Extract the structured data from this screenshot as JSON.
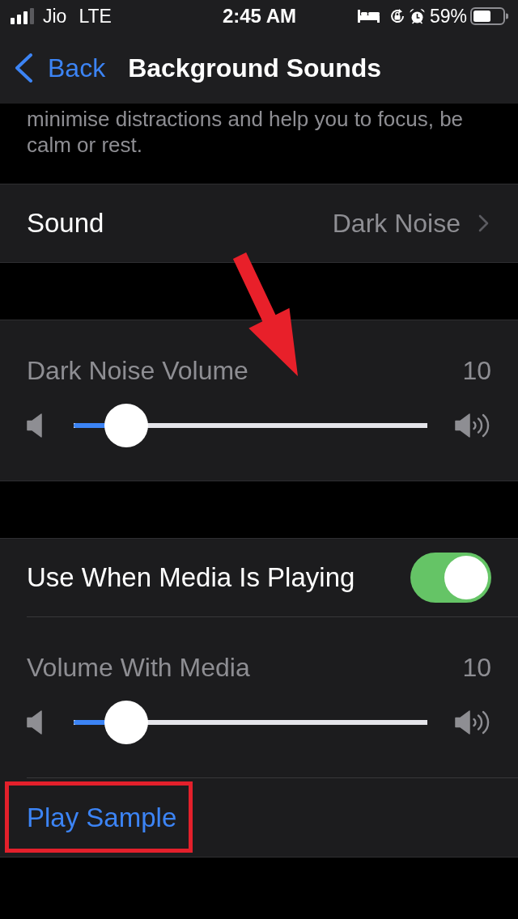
{
  "status_bar": {
    "carrier": "Jio",
    "network": "LTE",
    "time": "2:45 AM",
    "battery": "59%"
  },
  "nav_bar": {
    "back_label": "Back",
    "title": "Background Sounds"
  },
  "description": "minimise distractions and help you to focus, be calm or rest.",
  "groups": [
    {
      "rows": [
        {
          "kind": "disclosure",
          "label": "Sound",
          "value": "Dark Noise"
        }
      ]
    },
    {
      "rows": [
        {
          "kind": "slider",
          "label": "Dark Noise Volume",
          "reading": "10",
          "level": 0.1,
          "arrow_marked": true
        }
      ]
    },
    {
      "rows": [
        {
          "kind": "toggle",
          "label": "Use When Media Is Playing",
          "on": true
        },
        {
          "kind": "slider",
          "label": "Volume With Media",
          "reading": "10",
          "level": 0.1
        },
        {
          "kind": "action",
          "label": "Play Sample",
          "boxed": true
        }
      ]
    }
  ]
}
